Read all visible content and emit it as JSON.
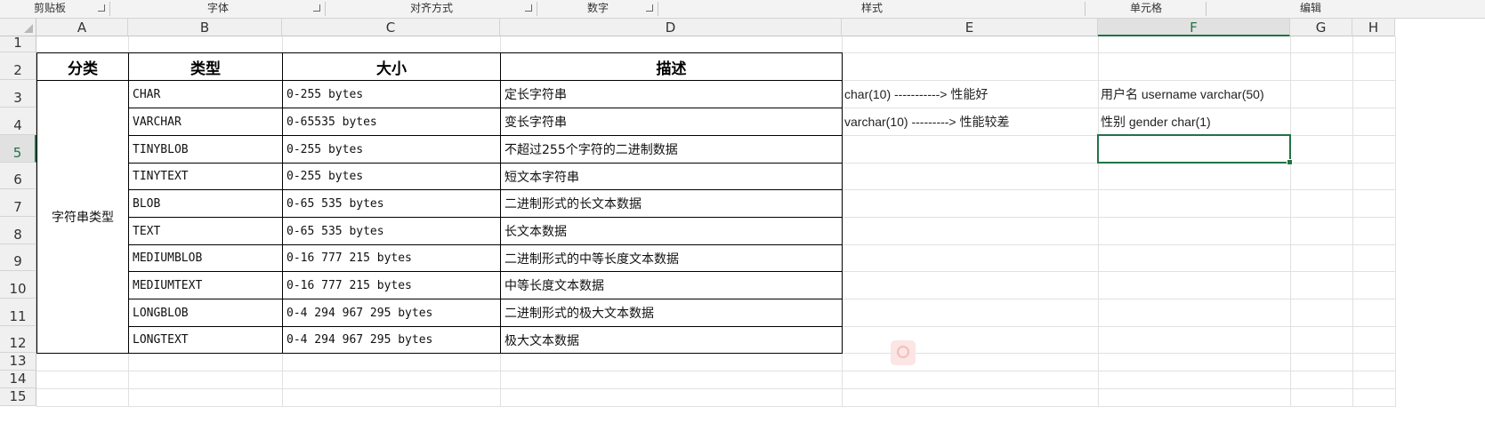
{
  "ribbon": {
    "groups": [
      "剪贴板",
      "字体",
      "对齐方式",
      "数字",
      "样式",
      "单元格",
      "编辑"
    ]
  },
  "columns": [
    "A",
    "B",
    "C",
    "D",
    "E",
    "F",
    "G",
    "H"
  ],
  "rows": [
    "1",
    "2",
    "3",
    "4",
    "5",
    "6",
    "7",
    "8",
    "9",
    "10",
    "11",
    "12",
    "13",
    "14",
    "15"
  ],
  "table": {
    "headers": [
      "分类",
      "类型",
      "大小",
      "描述"
    ],
    "category": "字符串类型",
    "rows": [
      {
        "type": "CHAR",
        "size": "0-255 bytes",
        "desc": "定长字符串"
      },
      {
        "type": "VARCHAR",
        "size": "0-65535 bytes",
        "desc": "变长字符串"
      },
      {
        "type": "TINYBLOB",
        "size": "0-255 bytes",
        "desc": "不超过255个字符的二进制数据"
      },
      {
        "type": "TINYTEXT",
        "size": "0-255 bytes",
        "desc": "短文本字符串"
      },
      {
        "type": "BLOB",
        "size": "0-65 535 bytes",
        "desc": "二进制形式的长文本数据"
      },
      {
        "type": "TEXT",
        "size": "0-65 535 bytes",
        "desc": "长文本数据"
      },
      {
        "type": "MEDIUMBLOB",
        "size": "0-16 777 215 bytes",
        "desc": "二进制形式的中等长度文本数据"
      },
      {
        "type": "MEDIUMTEXT",
        "size": "0-16 777 215 bytes",
        "desc": "中等长度文本数据"
      },
      {
        "type": "LONGBLOB",
        "size": "0-4 294 967 295 bytes",
        "desc": "二进制形式的极大文本数据"
      },
      {
        "type": "LONGTEXT",
        "size": "0-4 294 967 295 bytes",
        "desc": "极大文本数据"
      }
    ]
  },
  "notes": {
    "e3": "char(10) -----------> 性能好",
    "e4": "varchar(10) ---------> 性能较差",
    "f3": "用户名  username  varchar(50)",
    "f4": "性别  gender  char(1)"
  },
  "selection": {
    "cell": "F5",
    "column": "F",
    "row": "5"
  },
  "colors": {
    "accent": "#217346",
    "gridline": "#e1e1e1",
    "header_bg": "#f0f0f0"
  }
}
